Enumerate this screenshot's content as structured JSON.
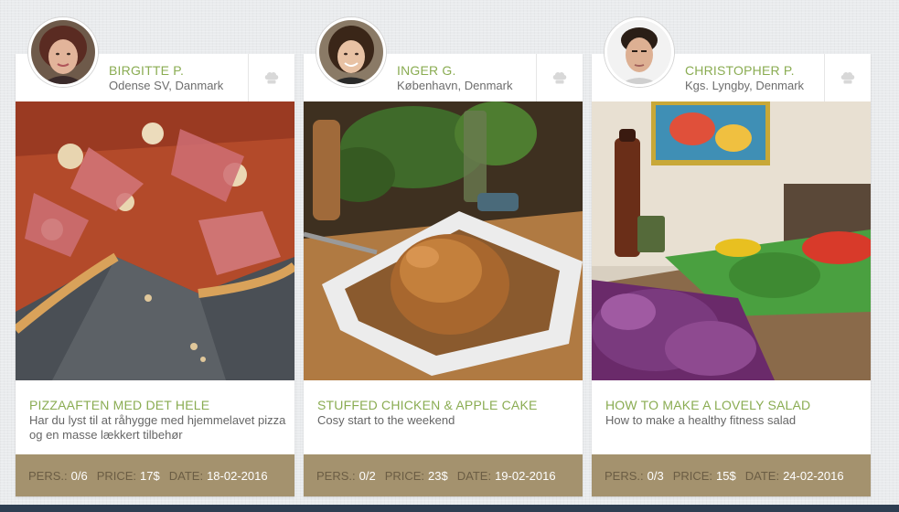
{
  "cards": [
    {
      "author": "BIRGITTE P.",
      "location": "Odense SV, Danmark",
      "title": "PIZZAAFTEN MED DET HELE",
      "description": "Har du lyst til at råhygge med hjemmelavet pizza og en masse lækkert tilbehør",
      "pers_label": "PERS.:",
      "pers_value": "0/6",
      "price_label": "PRICE:",
      "price_value": "17$",
      "date_label": "DATE:",
      "date_value": "18-02-2016",
      "icon": "chef-hat-icon"
    },
    {
      "author": "INGER G.",
      "location": "København, Denmark",
      "title": "STUFFED CHICKEN & APPLE CAKE",
      "description": "Cosy start to the weekend",
      "pers_label": "PERS.:",
      "pers_value": "0/2",
      "price_label": "PRICE:",
      "price_value": "23$",
      "date_label": "DATE:",
      "date_value": "19-02-2016",
      "icon": "chef-hat-icon"
    },
    {
      "author": "CHRISTOPHER P.",
      "location": "Kgs. Lyngby, Denmark",
      "title": "HOW TO MAKE A LOVELY SALAD",
      "description": "How to make a healthy fitness salad",
      "pers_label": "PERS.:",
      "pers_value": "0/3",
      "price_label": "PRICE:",
      "price_value": "15$",
      "date_label": "DATE:",
      "date_value": "24-02-2016",
      "icon": "chef-hat-icon"
    }
  ],
  "colors": {
    "accent_green": "#8aac52",
    "footer_bg": "#a4926e",
    "footer_label": "#6b5d44",
    "bottom_bar": "#2e3e52"
  }
}
